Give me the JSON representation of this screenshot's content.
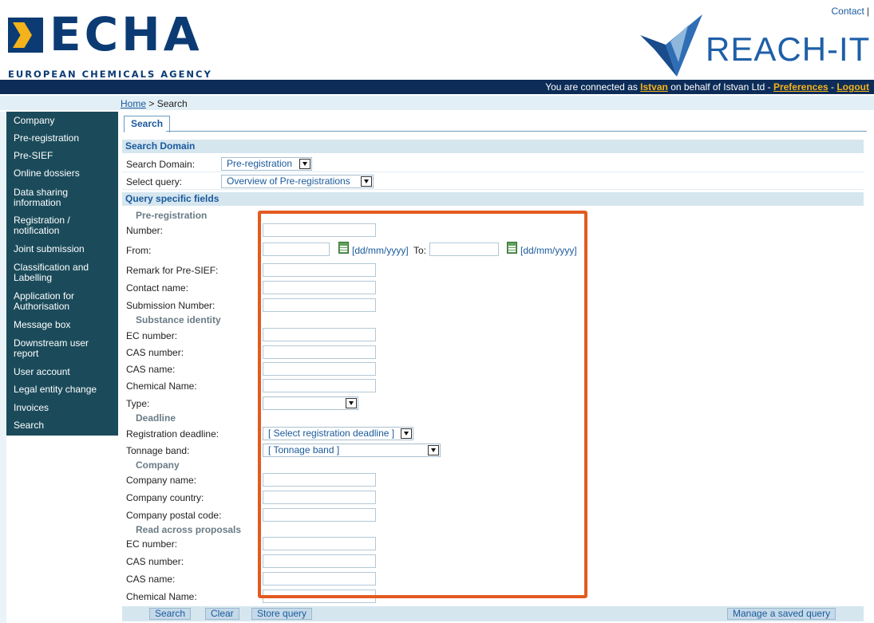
{
  "header": {
    "contact": "Contact",
    "echa_title": "ECHA",
    "echa_subtitle": "EUROPEAN CHEMICALS AGENCY",
    "reach_title": "REACH-IT"
  },
  "topbar": {
    "prefix": "You are connected as ",
    "user": "Istvan",
    "middle": " on behalf of Istvan Ltd - ",
    "preferences": "Preferences",
    "sep": " - ",
    "logout": "Logout"
  },
  "breadcrumb": {
    "home": "Home",
    "sep": " > ",
    "current": "Search"
  },
  "sidebar": {
    "items": [
      "Company",
      "Pre-registration",
      "Pre-SIEF",
      "Online dossiers",
      "Data sharing information",
      "Registration / notification",
      "Joint submission",
      "Classification and Labelling",
      "Application for Authorisation",
      "Message box",
      "Downstream user report",
      "User account",
      "Legal entity change",
      "Invoices",
      "Search"
    ]
  },
  "tab": {
    "label": "Search"
  },
  "search_domain": {
    "header": "Search Domain",
    "domain_label": "Search Domain:",
    "domain_value": "Pre-registration",
    "query_label": "Select query:",
    "query_value": "Overview of Pre-registrations"
  },
  "query_fields": {
    "header": "Query specific fields",
    "group_prereg": "Pre-registration",
    "number": "Number:",
    "from": "From:",
    "date_format": "[dd/mm/yyyy]",
    "to": "To:",
    "remark": "Remark for Pre-SIEF:",
    "contact_name": "Contact name:",
    "submission_number": "Submission Number:",
    "group_substance": "Substance identity",
    "ec_number": "EC number:",
    "cas_number": "CAS number:",
    "cas_name": "CAS name:",
    "chemical_name": "Chemical Name:",
    "type": "Type:",
    "group_deadline": "Deadline",
    "registration_deadline": "Registration deadline:",
    "registration_deadline_value": "[ Select registration deadline ]",
    "tonnage_band": "Tonnage band:",
    "tonnage_band_value": "[ Tonnage band ]",
    "group_company": "Company",
    "company_name": "Company name:",
    "company_country": "Company country:",
    "company_postal": "Company postal code:",
    "group_read_across": "Read across proposals",
    "ra_ec_number": "EC number:",
    "ra_cas_number": "CAS number:",
    "ra_cas_name": "CAS name:",
    "ra_chemical_name": "Chemical Name:"
  },
  "buttons": {
    "search": "Search",
    "clear": "Clear",
    "store": "Store query",
    "manage": "Manage a saved query"
  },
  "colors": {
    "navy": "#0d2d58",
    "sidebar": "#1b4b5b",
    "highlight": "#e35b20",
    "accent_yellow": "#f4b31a"
  }
}
